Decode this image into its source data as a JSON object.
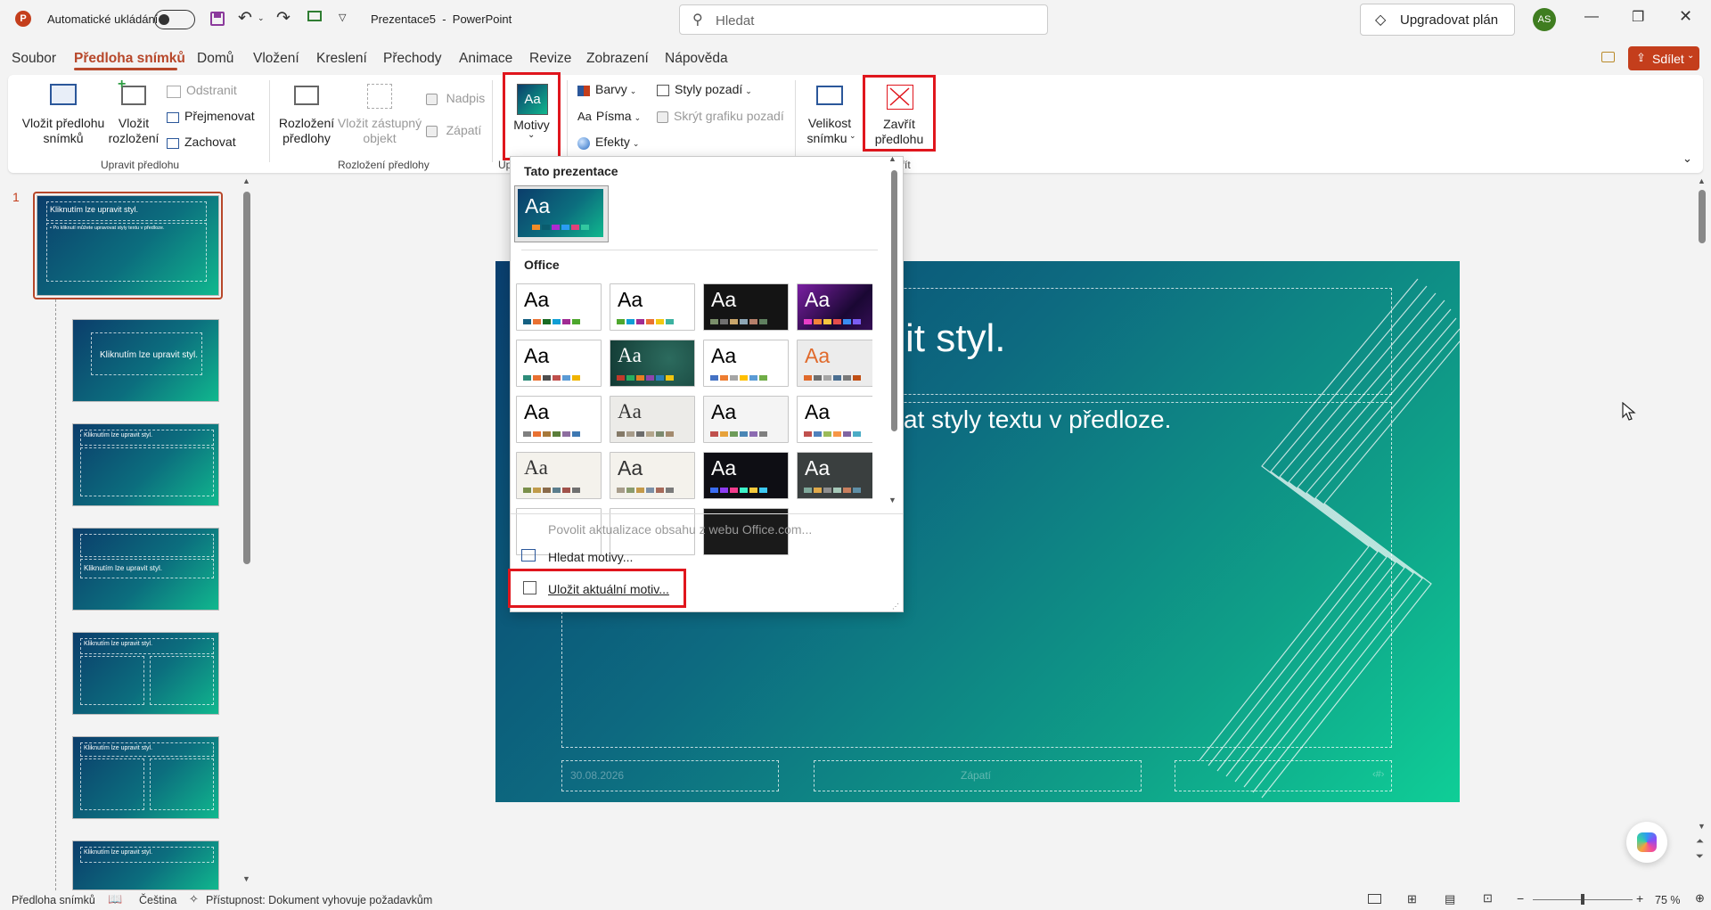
{
  "titlebar": {
    "autosave_label": "Automatické ukládání",
    "document_title": "Prezentace5  -  PowerPoint",
    "search_placeholder": "Hledat",
    "upgrade_label": "Upgradovat plán",
    "avatar_initials": "AS"
  },
  "menu": {
    "tabs": [
      "Soubor",
      "Předloha snímků",
      "Domů",
      "Vložení",
      "Kreslení",
      "Přechody",
      "Animace",
      "Revize",
      "Zobrazení",
      "Nápověda"
    ],
    "active_tab": "Předloha snímků",
    "share_label": "Sdílet"
  },
  "ribbon": {
    "insert_master": "Vložit předlohu snímků",
    "insert_master_l1": "Vložit předlohu",
    "insert_master_l2": "snímků",
    "insert_layout_l1": "Vložit",
    "insert_layout_l2": "rozložení",
    "delete": "Odstranit",
    "rename": "Přejmenovat",
    "preserve": "Zachovat",
    "group_edit_master": "Upravit předlohu",
    "master_layout_l1": "Rozložení",
    "master_layout_l2": "předlohy",
    "insert_placeholder_l1": "Vložit zástupný",
    "insert_placeholder_l2": "objekt",
    "title_chk": "Nadpis",
    "footer_chk": "Zápatí",
    "group_master_layout": "Rozložení předlohy",
    "themes": "Motivy",
    "colors": "Barvy",
    "fonts": "Písma",
    "effects": "Efekty",
    "bg_styles": "Styly pozadí",
    "hide_bg": "Skrýt grafiku pozadí",
    "slide_size_l1": "Velikost",
    "slide_size_l2": "snímku",
    "close_l1": "Zavřít",
    "close_l2": "předlohu",
    "group_edit_theme_partial": "Up",
    "group_close_partial": "řít",
    "accent_color": "#e0161d"
  },
  "dropdown": {
    "section_this": "Tato prezentace",
    "section_office": "Office",
    "allow_updates": "Povolit aktualizace obsahu z webu Office.com...",
    "browse": "Hledat motivy...",
    "save": "Uložit aktuální motiv..."
  },
  "thumbs": {
    "slide_number": "1",
    "master_title": "Kliknutím lze upravit styl.",
    "master_body": "• Po kliknutí můžete upravovat styly textu v předloze.",
    "layout_title": "Kliknutím lze upravit styl."
  },
  "slide": {
    "title_fragment": "it styl.",
    "body_fragment": "vat styly textu v předloze.",
    "date": "30.08.2026",
    "footer": "Zápatí",
    "page_num": "‹#›"
  },
  "status": {
    "view": "Předloha snímků",
    "language": "Čeština",
    "accessibility": "Přístupnost: Dokument vyhovuje požadavkům",
    "zoom": "75 %"
  }
}
